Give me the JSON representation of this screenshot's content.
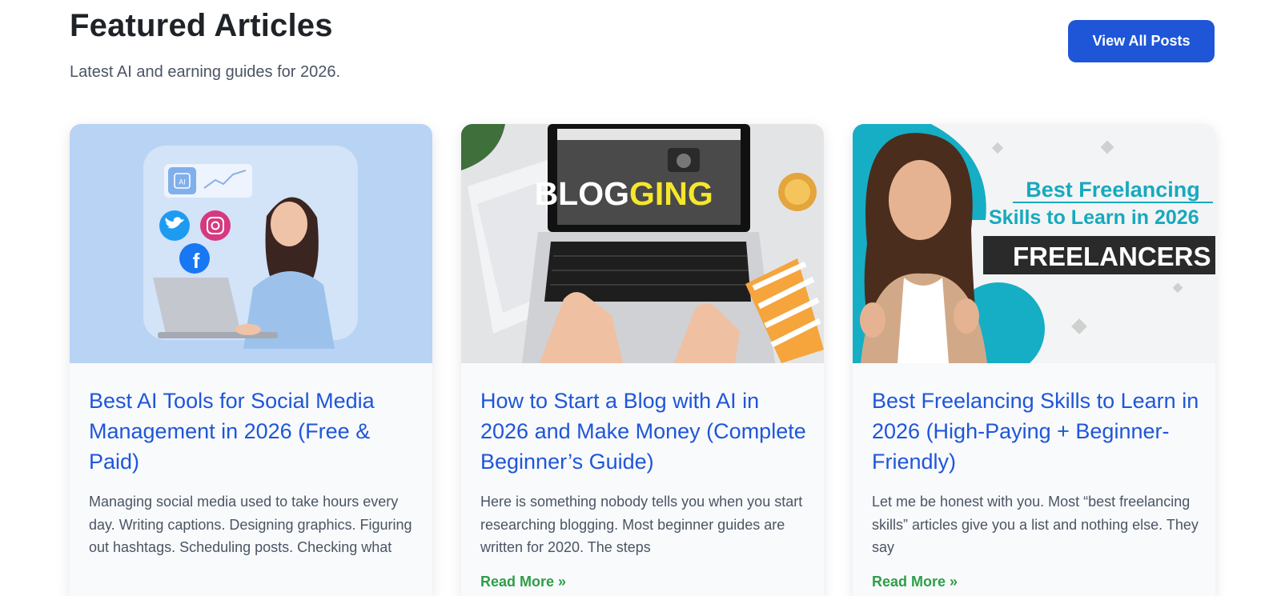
{
  "section": {
    "title": "Featured Articles",
    "subtitle": "Latest AI and earning guides for 2026.",
    "view_all_label": "View All Posts"
  },
  "articles": [
    {
      "title": "Best AI Tools for Social Media Management in 2026 (Free & Paid)",
      "excerpt": "Managing social media used to take hours every day. Writing captions. Designing graphics. Figuring out hashtags. Scheduling posts. Checking what",
      "read_more": "",
      "image_text": {
        "ai_badge": "AI"
      }
    },
    {
      "title": "How to Start a Blog with AI in 2026 and Make Money (Complete Beginner’s Guide)",
      "excerpt": "Here is something nobody tells you when you start researching blogging. Most beginner guides are written for 2020. The steps",
      "read_more": "Read More »",
      "image_text": {
        "part1": "BLOG",
        "part2": "GING"
      }
    },
    {
      "title": "Best Freelancing Skills to Learn in 2026 (High-Paying + Beginner-Friendly)",
      "excerpt": "Let me be honest with you. Most “best freelancing skills” articles give you a list and nothing else. They say",
      "read_more": "Read More »",
      "image_text": {
        "line1": "Best Freelancing",
        "line2": "Skills to Learn in 2026",
        "banner": "FREELANCERS"
      }
    }
  ],
  "colors": {
    "accent": "#1f56d8",
    "read_more": "#2e9e47",
    "card_bg": "#f8fafc"
  }
}
